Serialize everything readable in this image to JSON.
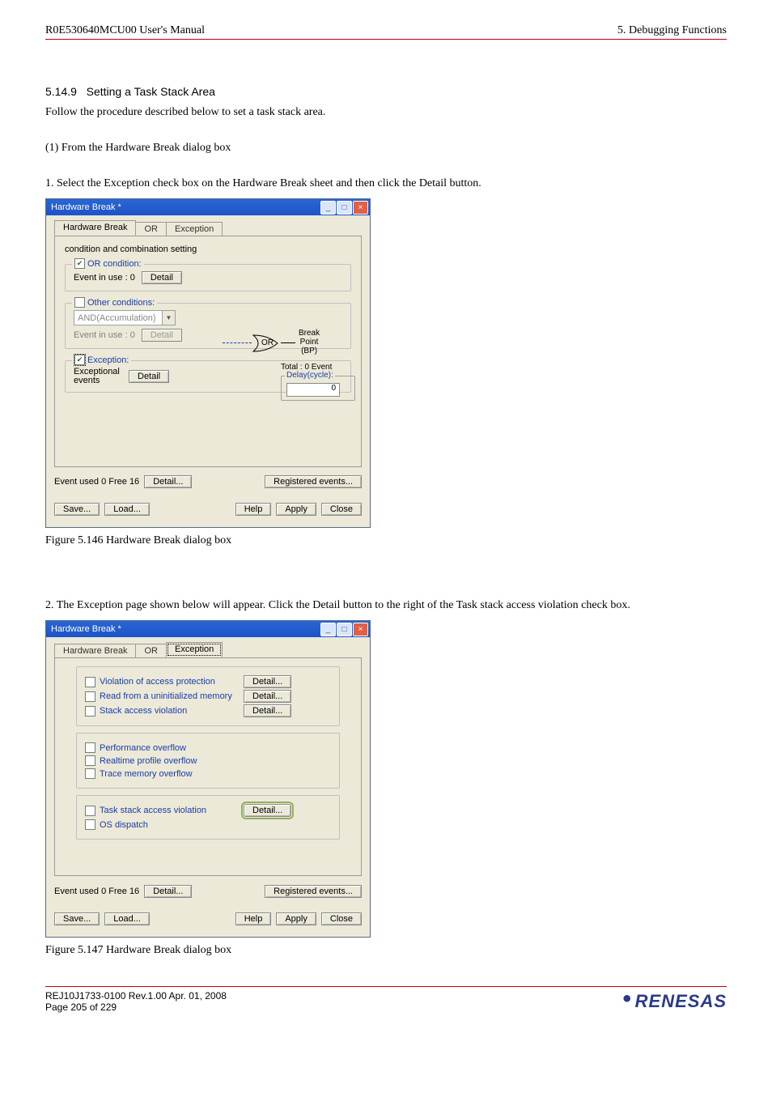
{
  "header": {
    "left": "R0E530640MCU00 User's Manual",
    "right": "5. Debugging Functions"
  },
  "section": {
    "number": "5.14.9",
    "title": "Setting a Task Stack Area",
    "intro": "Follow the procedure described below to set a task stack area.",
    "step_heading_1": "(1) From the Hardware Break dialog box",
    "step1": "1. Select the Exception check box on the Hardware Break sheet and then click the Detail button.",
    "step2": "2. The Exception page shown below will appear. Click the Detail button to the right of the Task stack access violation check box."
  },
  "dialog1": {
    "title": "Hardware Break *",
    "tabs": {
      "t1": "Hardware Break",
      "t2": "OR",
      "t3": "Exception"
    },
    "cond_heading": "condition and combination setting",
    "or_cond_label": "OR condition:",
    "event_in_use": "Event in use : 0",
    "detail_btn": "Detail",
    "other_cond_label": "Other conditions:",
    "and_accum": "AND(Accumulation)",
    "exception_label": "Exception:",
    "exceptional_events": "Exceptional events",
    "or_gate_label": "OR",
    "bp_label_l1": "Break",
    "bp_label_l2": "Point",
    "bp_label_l3": "(BP)",
    "total_label": "Total : 0   Event",
    "delay_label": "Delay(cycle):",
    "delay_value": "0",
    "event_used_label": "Event used   0  Free 16",
    "registered_events": "Registered events...",
    "save": "Save...",
    "load": "Load...",
    "help": "Help",
    "apply": "Apply",
    "close": "Close"
  },
  "caption1": "Figure 5.146 Hardware Break dialog box",
  "dialog2": {
    "title": "Hardware Break *",
    "tabs": {
      "t1": "Hardware Break",
      "t2": "OR",
      "t3": "Exception"
    },
    "items": {
      "violation": "Violation of access protection",
      "read_uninit": "Read from a uninitialized memory",
      "stack_access": "Stack access violation",
      "perf_overflow": "Performance overflow",
      "realtime_overflow": "Realtime profile overflow",
      "trace_overflow": "Trace memory overflow",
      "task_stack": "Task stack access violation",
      "os_dispatch": "OS dispatch"
    },
    "detail_btn": "Detail...",
    "event_used_label": "Event used   0  Free 16",
    "registered_events": "Registered events...",
    "save": "Save...",
    "load": "Load...",
    "help": "Help",
    "apply": "Apply",
    "close": "Close"
  },
  "caption2": "Figure 5.147 Hardware Break dialog box",
  "footer": {
    "line1": "REJ10J1733-0100   Rev.1.00   Apr. 01, 2008",
    "line2": "Page 205 of 229",
    "logo": "RENESAS"
  }
}
